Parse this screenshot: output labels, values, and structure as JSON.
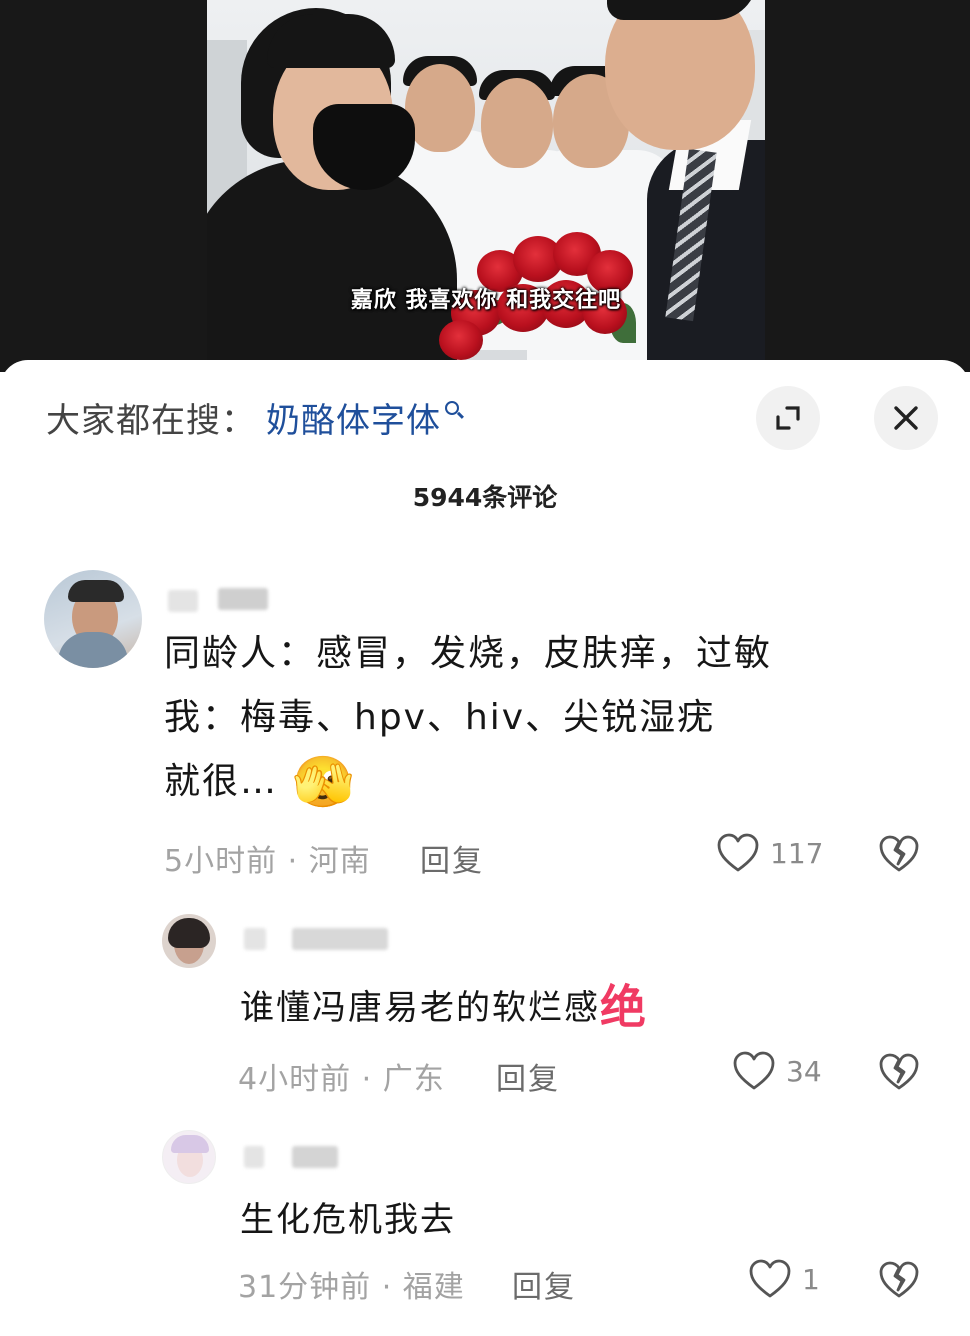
{
  "video": {
    "subtitle": "嘉欣 我喜欢你 和我交往吧"
  },
  "search": {
    "prefix": "大家都在搜：",
    "term": "奶酪体字体",
    "icon": "search-icon"
  },
  "header_buttons": {
    "expand_icon": "expand-icon",
    "close_icon": "close-icon"
  },
  "comments_header": {
    "count_label": "5944条评论"
  },
  "comments": [
    {
      "lines": [
        "同龄人：感冒，发烧，皮肤痒，过敏",
        "我：梅毒、hpv、hiv、尖锐湿疣",
        "就很…"
      ],
      "emoji": "🫣",
      "time_location": "5小时前 · 河南",
      "reply_label": "回复",
      "likes": "117"
    }
  ],
  "replies": [
    {
      "text": "谁懂冯唐易老的软烂感",
      "highlight": "绝",
      "time_location": "4小时前 · 广东",
      "reply_label": "回复",
      "likes": "34"
    },
    {
      "text": "生化危机我去",
      "time_location": "31分钟前 · 福建",
      "reply_label": "回复",
      "likes": "1"
    }
  ],
  "colors": {
    "search_term": "#1f4f9b",
    "highlight": "#f03a63",
    "meta": "#a3a3a3"
  }
}
